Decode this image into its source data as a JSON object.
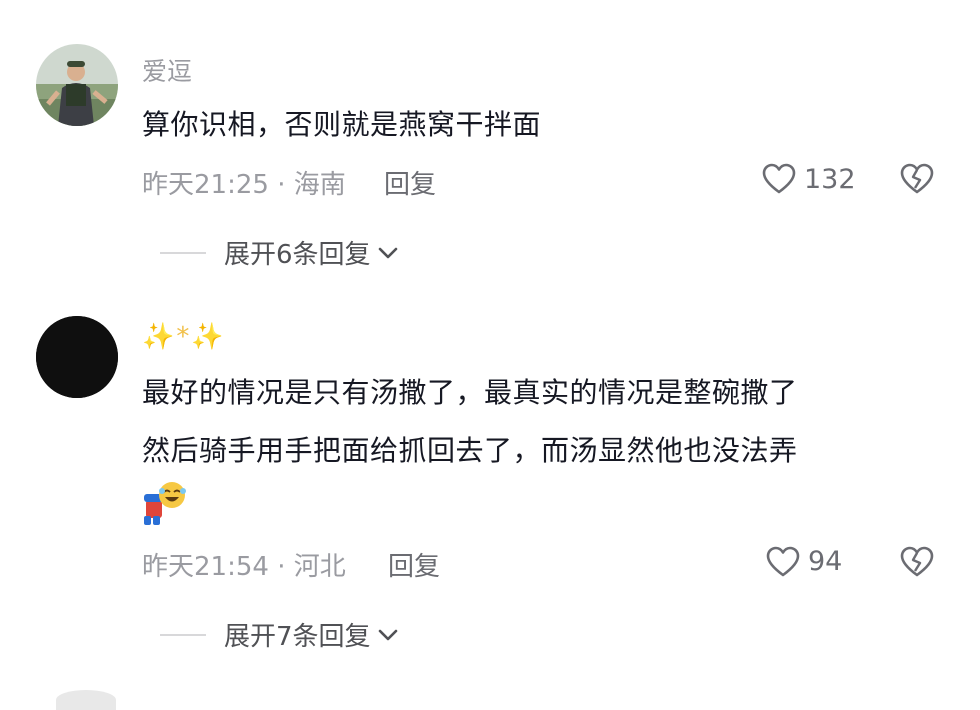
{
  "comments": [
    {
      "username": "爱逗",
      "text_lines": [
        "算你识相，否则就是燕窝干拌面"
      ],
      "time": "昨天21:25",
      "location": "海南",
      "meta_sep": " · ",
      "reply_label": "回复",
      "likes": "132",
      "expand_label": "展开6条回复",
      "avatar_icon": "hiker-photo-avatar"
    },
    {
      "username": "✨*✨",
      "text_lines": [
        "最好的情况是只有汤撒了，最真实的情况是整碗撒了",
        "然后骑手用手把面给抓回去了，而汤显然他也没法弄"
      ],
      "emoji": "laughing-crying-bow-emoji",
      "time": "昨天21:54",
      "location": "河北",
      "meta_sep": " · ",
      "reply_label": "回复",
      "likes": "94",
      "expand_label": "展开7条回复",
      "avatar_icon": "black-circle-avatar"
    }
  ],
  "colors": {
    "text_primary": "#161823",
    "text_secondary": "#9a9ba1",
    "icon": "#6b6c72",
    "background": "#ffffff"
  }
}
